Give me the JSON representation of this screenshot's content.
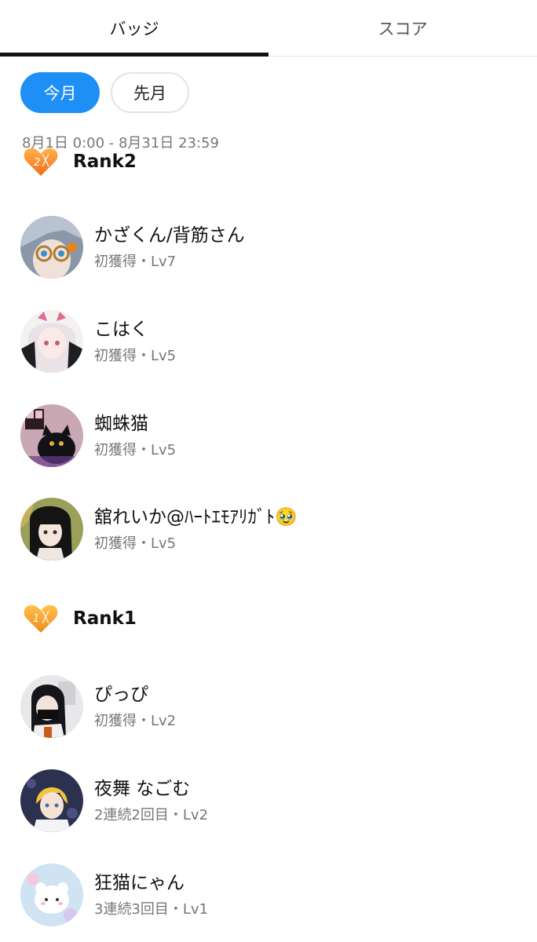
{
  "tabs": [
    {
      "label": "バッジ",
      "active": true
    },
    {
      "label": "スコア",
      "active": false
    }
  ],
  "period": {
    "this_month": "今月",
    "last_month": "先月",
    "selected": "今月",
    "range": "8月1日 0:00 - 8月31日 23:59"
  },
  "colors": {
    "accent": "#1e8ff5",
    "rank_badge": "#f7941d"
  },
  "ranks": [
    {
      "label": "Rank2",
      "icon": "heart-badge-icon",
      "users": [
        {
          "name": "かざくん/背筋さん",
          "sub": "初獲得・Lv7"
        },
        {
          "name": "こはく",
          "sub": "初獲得・Lv5"
        },
        {
          "name": "蜘蛛猫",
          "sub": "初獲得・Lv5"
        },
        {
          "name": "舘れいか@ﾊｰﾄｴﾓｱﾘｶﾞﾄ🥹",
          "sub": "初獲得・Lv5"
        }
      ]
    },
    {
      "label": "Rank1",
      "icon": "heart-badge-icon",
      "users": [
        {
          "name": "ぴっぴ",
          "sub": "初獲得・Lv2"
        },
        {
          "name": "夜舞 なごむ",
          "sub": "2連続2回目・Lv2"
        },
        {
          "name": "狂猫にゃん",
          "sub": "3連続3回目・Lv1"
        }
      ]
    }
  ]
}
